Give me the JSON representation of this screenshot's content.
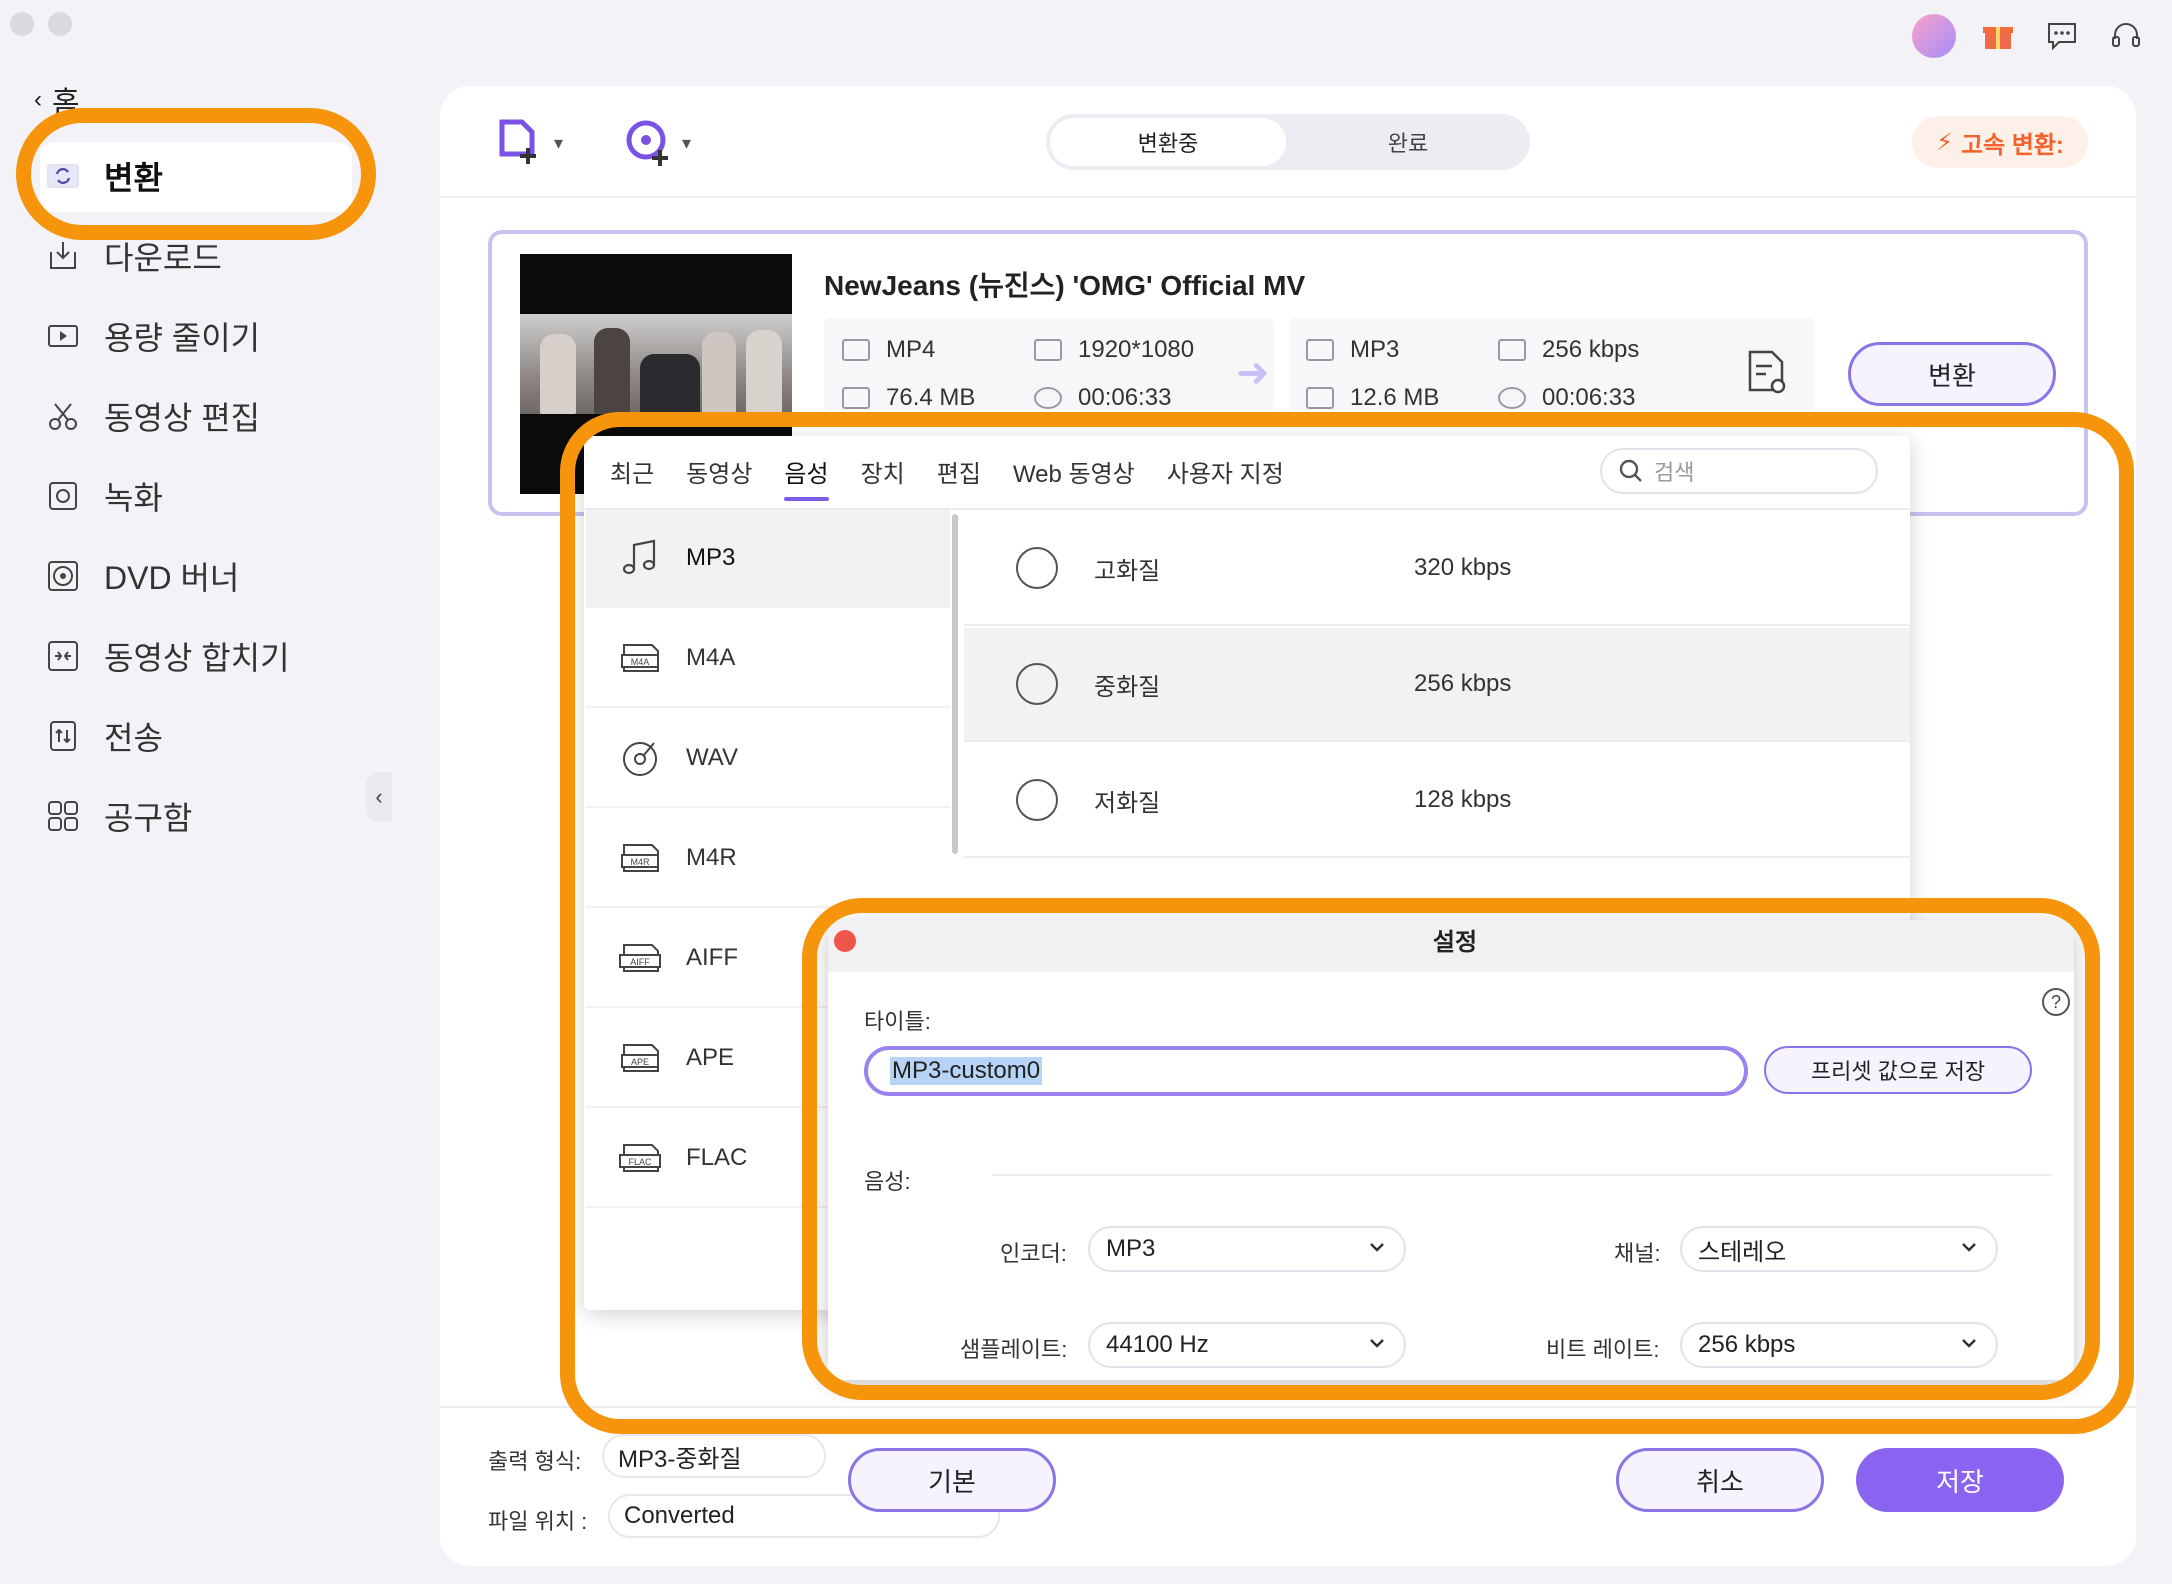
{
  "sidebar": {
    "home": "홈",
    "items": [
      {
        "label": "변환",
        "icon": "convert-icon"
      },
      {
        "label": "다운로드",
        "icon": "download-icon"
      },
      {
        "label": "용량 줄이기",
        "icon": "compress-icon"
      },
      {
        "label": "동영상 편집",
        "icon": "scissors-icon"
      },
      {
        "label": "녹화",
        "icon": "record-icon"
      },
      {
        "label": "DVD 버너",
        "icon": "dvd-icon"
      },
      {
        "label": "동영상 합치기",
        "icon": "merge-icon"
      },
      {
        "label": "전송",
        "icon": "transfer-icon"
      },
      {
        "label": "공구함",
        "icon": "toolbox-icon"
      }
    ]
  },
  "header": {
    "tab_converting": "변환중",
    "tab_done": "완료",
    "fast_convert": "고속 변환:"
  },
  "file": {
    "title": "NewJeans (뉴진스) 'OMG' Official MV",
    "src_format": "MP4",
    "src_resolution": "1920*1080",
    "src_size": "76.4 MB",
    "src_duration": "00:06:33",
    "dst_format": "MP3",
    "dst_bitrate": "256 kbps",
    "dst_size": "12.6 MB",
    "dst_duration": "00:06:33",
    "convert_button": "변환"
  },
  "format_panel": {
    "tabs": [
      "최근",
      "동영상",
      "음성",
      "장치",
      "편집",
      "Web 동영상",
      "사용자 지정"
    ],
    "active_tab": "음성",
    "search_placeholder": "검색",
    "formats": [
      "MP3",
      "M4A",
      "WAV",
      "M4R",
      "AIFF",
      "APE",
      "FLAC"
    ],
    "qualities": [
      {
        "label": "고화질",
        "value": "320 kbps"
      },
      {
        "label": "중화질",
        "value": "256 kbps"
      },
      {
        "label": "저화질",
        "value": "128 kbps"
      }
    ]
  },
  "settings": {
    "title": "설정",
    "title_label": "타이틀:",
    "title_value": "MP3-custom0",
    "save_preset": "프리셋 값으로 저장",
    "audio_label": "음성:",
    "encoder_label": "인코더:",
    "encoder_value": "MP3",
    "channel_label": "채널:",
    "channel_value": "스테레오",
    "samplerate_label": "샘플레이트:",
    "samplerate_value": "44100 Hz",
    "bitrate_label": "비트 레이트:",
    "bitrate_value": "256 kbps"
  },
  "bottom": {
    "output_label": "출력 형식:",
    "output_value": "MP3-중화질",
    "location_label": "파일 위치 :",
    "location_value": "Converted",
    "default_button": "기본",
    "cancel_button": "취소",
    "save_button": "저장"
  },
  "colors": {
    "accent": "#8a63f0",
    "highlight": "#f6940c",
    "fast": "#f2622a"
  }
}
